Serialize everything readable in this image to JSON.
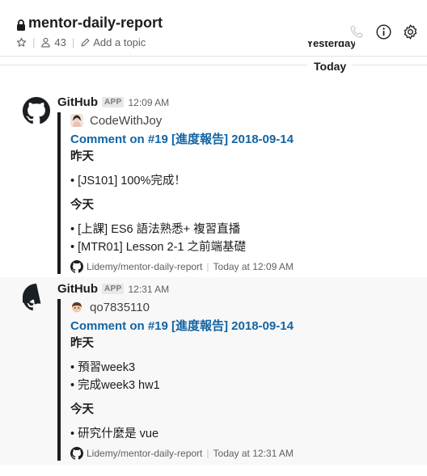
{
  "header": {
    "channel_name": "mentor-daily-report",
    "member_count": "43",
    "add_topic": "Add a topic"
  },
  "divider": {
    "yesterday": "Yesterday",
    "today": "Today"
  },
  "messages": [
    {
      "sender": "GitHub",
      "badge": "APP",
      "time": "12:09 AM",
      "author": "CodeWithJoy",
      "title": "Comment on #19 [進度報告] 2018-09-14",
      "lines": {
        "h1": "昨天",
        "a": "• [JS101] 100%完成！",
        "h2": "今天",
        "b": "• [上課] ES6 語法熟悉+ 複習直播",
        "c": "• [MTR01] Lesson 2-1 之前端基礎"
      },
      "repo": "Lidemy/mentor-daily-report",
      "footer_time": "Today at 12:09 AM"
    },
    {
      "sender": "GitHub",
      "badge": "APP",
      "time": "12:31 AM",
      "author": "qo7835110",
      "title": "Comment on #19 [進度報告] 2018-09-14",
      "lines": {
        "h1": "昨天",
        "a": "• 預習week3",
        "b": "• 完成week3 hw1",
        "h2": "今天",
        "c": "• 研究什麼是 vue"
      },
      "repo": "Lidemy/mentor-daily-report",
      "footer_time": "Today at 12:31 AM"
    }
  ],
  "colors": {
    "link": "#1264a3",
    "attachment_bar": "#1d1c1d",
    "hover_bg": "#f8f8f8"
  }
}
